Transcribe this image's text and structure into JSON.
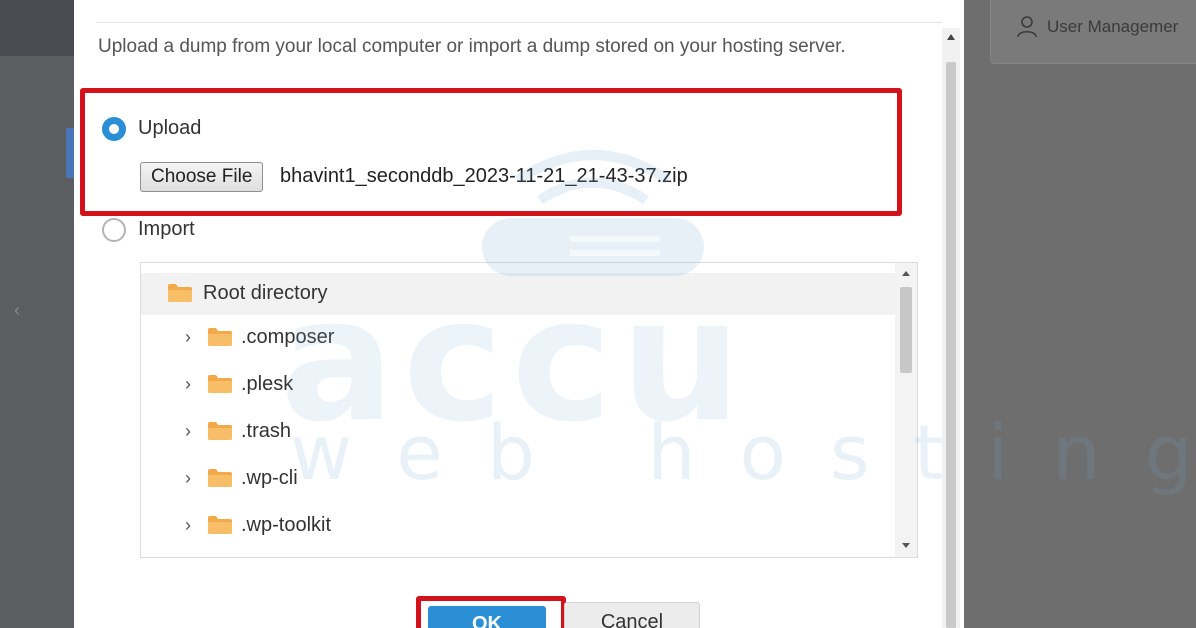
{
  "background": {
    "user_management_label": "User Managemer"
  },
  "dialog": {
    "description": "Upload a dump from your local computer or import a dump stored on your hosting server.",
    "options": {
      "upload_label": "Upload",
      "import_label": "Import",
      "selected": "upload"
    },
    "file_input": {
      "button_label": "Choose File",
      "file_name": "bhavint1_seconddb_2023-11-21_21-43-37.zip"
    },
    "tree": {
      "root_label": "Root directory",
      "items": [
        {
          "label": ".composer"
        },
        {
          "label": ".plesk"
        },
        {
          "label": ".trash"
        },
        {
          "label": ".wp-cli"
        },
        {
          "label": ".wp-toolkit"
        }
      ]
    },
    "buttons": {
      "ok_label": "OK",
      "cancel_label": "Cancel"
    }
  },
  "watermark": {
    "brand": "accu",
    "tagline": "web hosting"
  },
  "colors": {
    "accent": "#2b8fd6",
    "highlight": "#d3131c",
    "folder": "#f2a94a"
  }
}
